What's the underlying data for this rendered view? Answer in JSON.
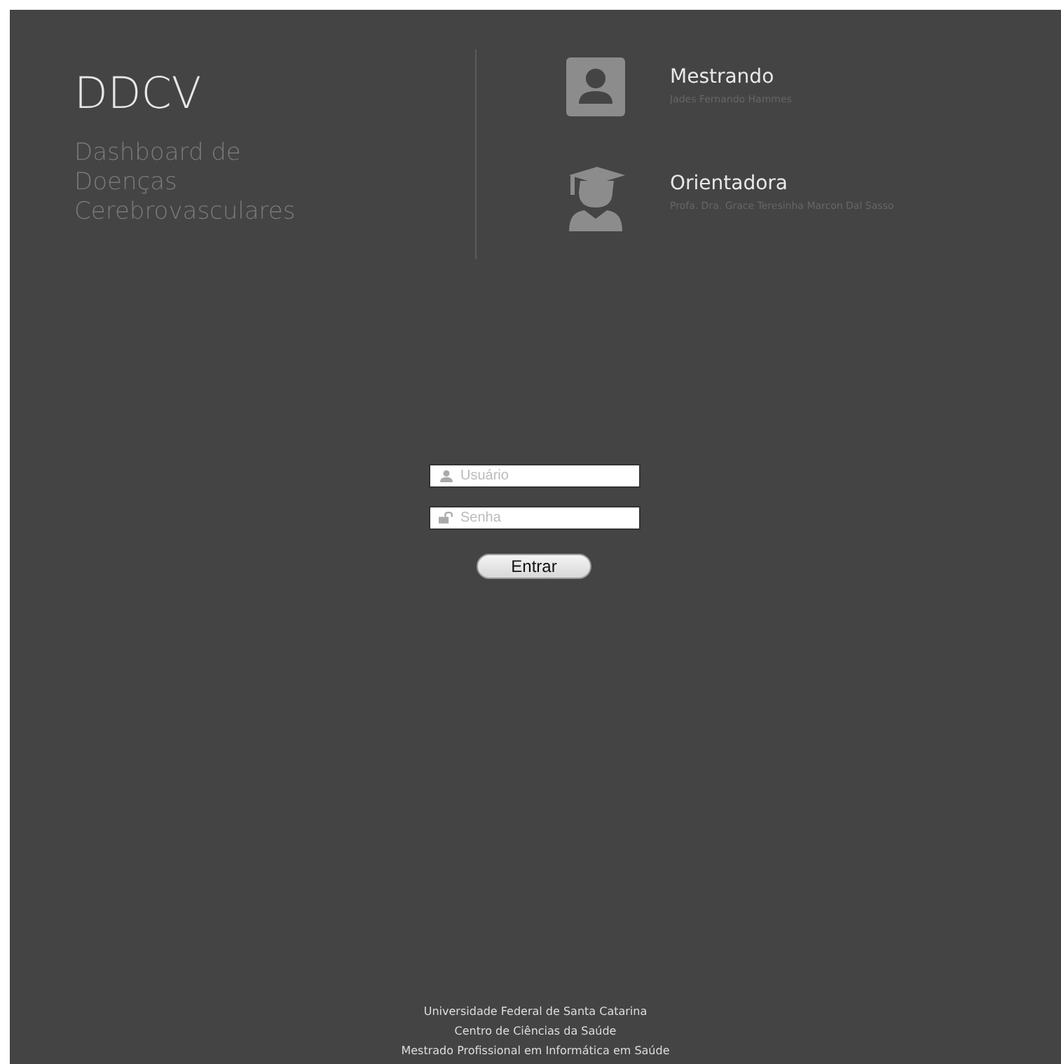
{
  "header": {
    "title": "DDCV",
    "subtitle": "Dashboard de Doenças Cerebrovasculares"
  },
  "people": [
    {
      "kind": "student",
      "role": "Mestrando",
      "name": "Jades Fernando Hammes"
    },
    {
      "kind": "advisor",
      "role": "Orientadora",
      "name": "Profa. Dra. Grace Teresinha Marcon Dal Sasso"
    }
  ],
  "login": {
    "fields": [
      {
        "kind": "user",
        "placeholder": "Usuário"
      },
      {
        "kind": "password",
        "placeholder": "Senha"
      }
    ],
    "button": "Entrar"
  },
  "footer": [
    "Universidade Federal de Santa Catarina",
    "Centro de Ciências da Saúde",
    "Mestrado Profissional em Informática em Saúde"
  ]
}
